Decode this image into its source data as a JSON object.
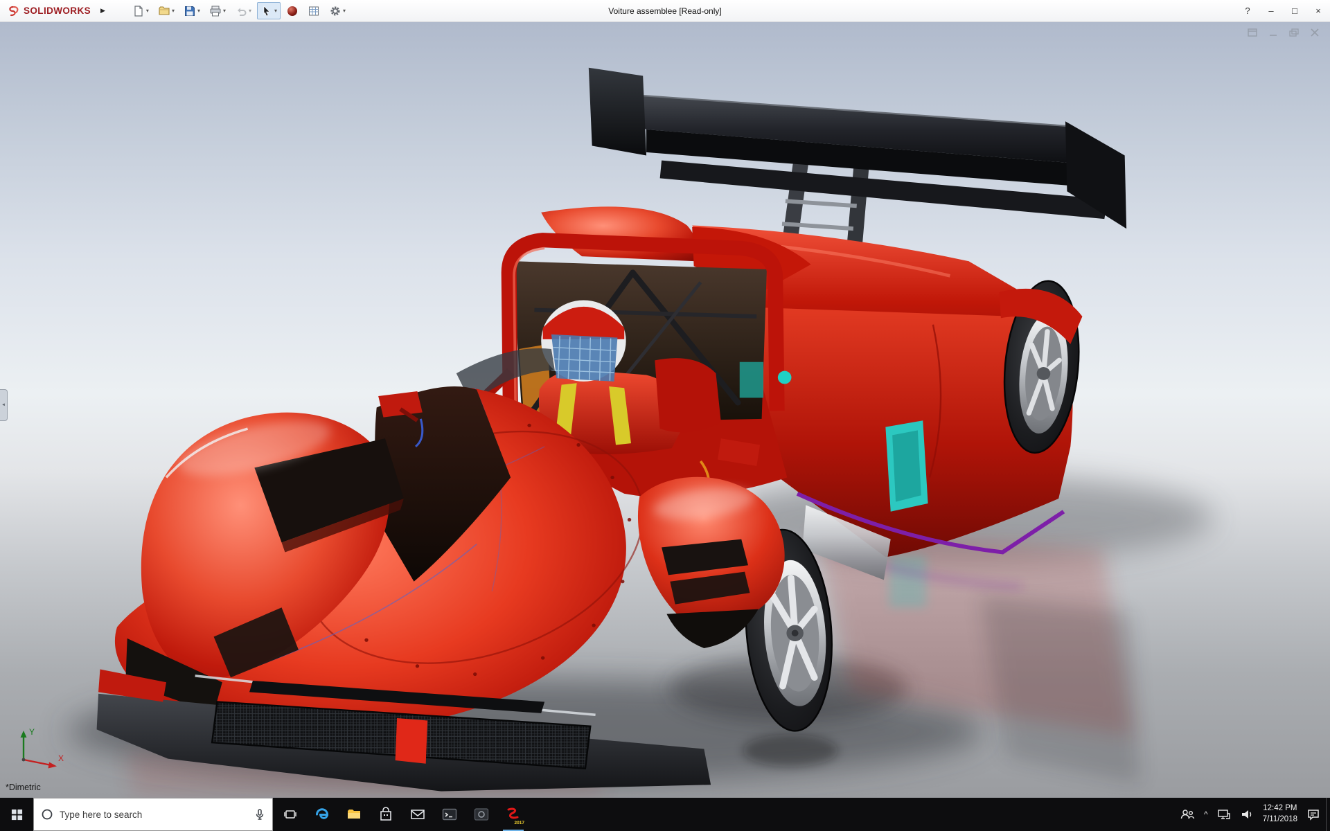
{
  "app": {
    "logo_text": "SOLIDWORKS",
    "flyout_arrow": "▶",
    "document_title": "Voiture assemblee [Read-only]",
    "window_controls": {
      "help": "?",
      "minimize": "–",
      "maximize": "□",
      "close": "×"
    }
  },
  "toolbar": {
    "dropdown_glyph": "▾",
    "item_names": [
      "new-document",
      "open",
      "save",
      "print",
      "undo",
      "select",
      "apply-scene",
      "design-table",
      "options"
    ]
  },
  "viewport": {
    "view_orientation_label": "*Dimetric",
    "triad": {
      "x_label": "X",
      "y_label": "Y"
    },
    "flyout_handle_glyph": "◄",
    "doc_window_icon_names": [
      "dock",
      "minimize",
      "restore",
      "close"
    ]
  },
  "taskbar": {
    "search_placeholder": "Type here to search",
    "sw_badge_year": "2017",
    "icon_names": [
      "start",
      "cortana-circle",
      "microphone",
      "task-view",
      "edge",
      "file-explorer",
      "store",
      "mail",
      "console",
      "dark-app",
      "solidworks"
    ],
    "tray": {
      "hidden_icons_chevron": "^",
      "icon_names": [
        "people",
        "network",
        "volume",
        "action-center",
        "show-desktop"
      ],
      "time": "12:42 PM",
      "date": "7/11/2018"
    }
  },
  "colors": {
    "solidworks_red": "#c8332e",
    "car_body_red": "#d42015",
    "wing_black": "#111214",
    "accent_cyan": "#2cc8c0",
    "accent_purple": "#7d1fa8",
    "taskbar_bg": "#0d0d0f",
    "viewport_sky": "#b3bdcf",
    "viewport_floor": "#9b9da1"
  }
}
